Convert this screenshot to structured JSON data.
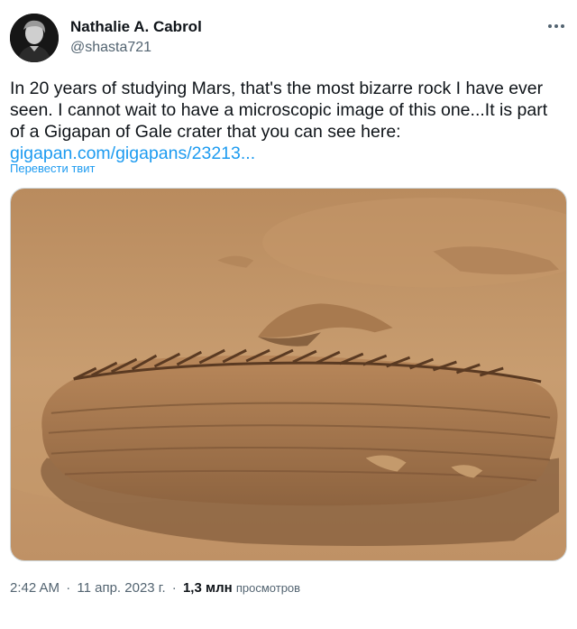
{
  "author": {
    "name": "Nathalie A. Cabrol",
    "handle": "@shasta721"
  },
  "tweet": {
    "text_before_link": "In 20 years of studying Mars, that's the most bizarre rock I have ever seen. I cannot wait to have a microscopic image of this one...It is part of a Gigapan of Gale crater that you can see here: ",
    "link_text": "gigapan.com/gigapans/23213...",
    "translate_label": "Перевести твит"
  },
  "meta": {
    "time": "2:42 AM",
    "date": "11 апр. 2023 г.",
    "views_count": "1,3 млн",
    "views_label": "просмотров",
    "separator": "·"
  },
  "icons": {
    "more": "more-horizontal-icon"
  },
  "colors": {
    "link": "#1d9bf0",
    "secondary_text": "#536471",
    "primary_text": "#0f1419",
    "mars_sand": "#c99a6b",
    "rock": "#a9794e"
  }
}
